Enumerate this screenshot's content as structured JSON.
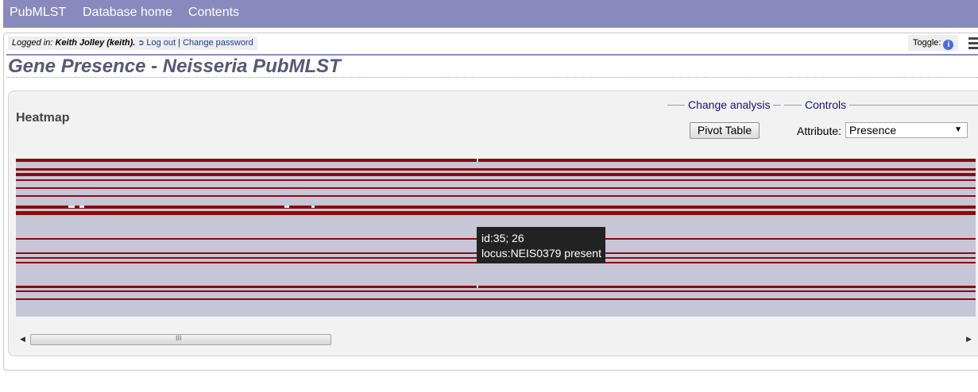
{
  "nav": {
    "items": [
      "PubMLST",
      "Database home",
      "Contents"
    ]
  },
  "login": {
    "prefix": "Logged in:",
    "user": "Keith Jolley (keith).",
    "logout": "Log out",
    "separator": "|",
    "change_password": "Change password"
  },
  "toggle": {
    "label": "Toggle:",
    "icon": "info-icon"
  },
  "page": {
    "title": "Gene Presence - Neisseria PubMLST"
  },
  "panel": {
    "heatmap_label": "Heatmap",
    "change_analysis_legend": "Change analysis",
    "pivot_button": "Pivot Table",
    "controls_legend": "Controls",
    "attribute_label": "Attribute:",
    "attribute_selected": "Presence"
  },
  "tooltip": {
    "line1": "id:35; 26",
    "line2": "locus:NEIS0379 present"
  },
  "scrollbar": {
    "grip": "III"
  },
  "colors": {
    "nav_bg": "#8989bd",
    "present": "#8b0b0b",
    "absent": "#c6c6d6",
    "title": "#57577a"
  }
}
